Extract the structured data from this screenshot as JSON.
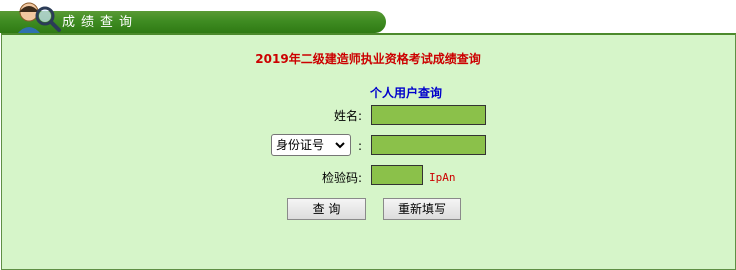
{
  "header": {
    "title": "成绩查询"
  },
  "page": {
    "title": "2019年二级建造师执业资格考试成绩查询",
    "section_title": "个人用户查询"
  },
  "form": {
    "name_label": "姓名:",
    "id_type_selected": "身份证号",
    "id_colon": ":",
    "captcha_label": "检验码:",
    "captcha_code": "IpAn",
    "name_value": "",
    "id_value": "",
    "captcha_value": ""
  },
  "buttons": {
    "query": "查 询",
    "reset": "重新填写"
  },
  "colors": {
    "header_green": "#3f8c22",
    "panel_bg": "#d6f5c9",
    "field_bg": "#8bc14a",
    "title_red": "#cc0000",
    "section_blue": "#0000cc"
  }
}
